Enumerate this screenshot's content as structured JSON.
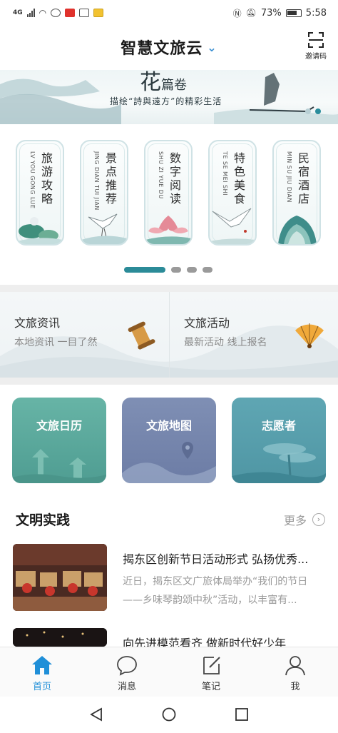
{
  "status": {
    "battery": "73%",
    "time": "5:58",
    "net": "4G"
  },
  "header": {
    "title": "智慧文旅云",
    "invite_label": "邀请码"
  },
  "banner": {
    "calligraphy": "花",
    "calligraphy_small": "篇卷",
    "slogan": "描绘“詩與遠方”的精彩生活"
  },
  "categories": [
    {
      "title": "旅游攻略",
      "pinyin": "LV YOU GONG LUE"
    },
    {
      "title": "景点推荐",
      "pinyin": "JING DIAN TUI JIAN"
    },
    {
      "title": "数字阅读",
      "pinyin": "SHU ZI YUE DU"
    },
    {
      "title": "特色美食",
      "pinyin": "TE SE MEI SHI"
    },
    {
      "title": "民宿酒店",
      "pinyin": "MIN SU JIU DIAN"
    }
  ],
  "panels": [
    {
      "title": "文旅资讯",
      "sub": "本地资讯 一目了然"
    },
    {
      "title": "文旅活动",
      "sub": "最新活动 线上报名"
    }
  ],
  "tiles": [
    {
      "label": "文旅日历",
      "color": "#5fb0a4"
    },
    {
      "label": "文旅地图",
      "color": "#7b8bb0"
    },
    {
      "label": "志愿者",
      "color": "#5aa0ae"
    }
  ],
  "section": {
    "title": "文明实践",
    "more": "更多"
  },
  "articles": [
    {
      "title": "揭东区创新节日活动形式 弘扬优秀...",
      "desc": "近日，揭东区文广旅体局举办“我们的节日——乡味琴韵颂中秋”活动，以丰富有..."
    },
    {
      "title": "向先进模范看齐 做新时代好少年",
      "desc": ""
    }
  ],
  "tabbar": [
    {
      "label": "首页",
      "icon": "home-icon",
      "active": true
    },
    {
      "label": "消息",
      "icon": "message-icon",
      "active": false
    },
    {
      "label": "笔记",
      "icon": "note-icon",
      "active": false
    },
    {
      "label": "我",
      "icon": "profile-icon",
      "active": false
    }
  ],
  "colors": {
    "accent": "#1f8fd8",
    "teal": "#2b8b98"
  }
}
